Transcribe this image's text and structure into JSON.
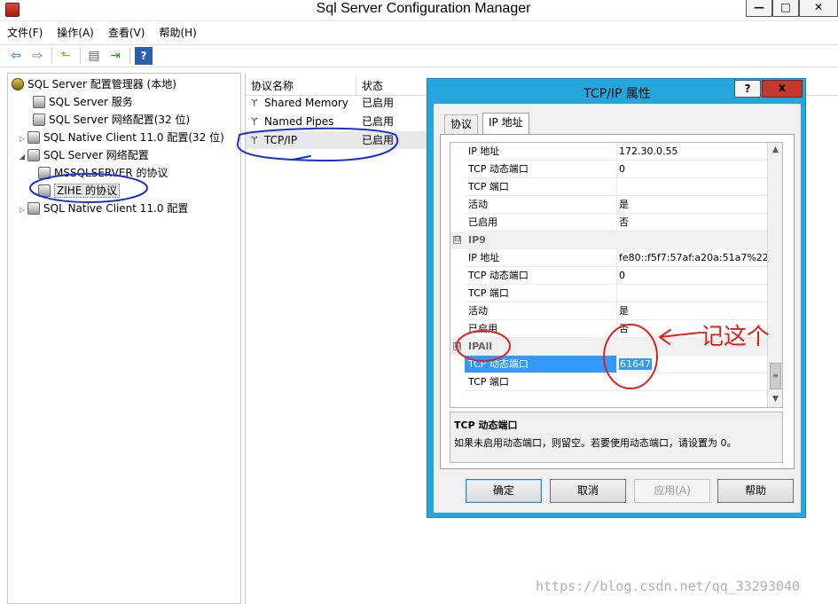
{
  "app": {
    "title": "Sql Server Configuration Manager",
    "window_controls": {
      "minimize": "—",
      "maximize": "□",
      "close": "✕"
    }
  },
  "menubar": [
    "文件(F)",
    "操作(A)",
    "查看(V)",
    "帮助(H)"
  ],
  "toolbar": {
    "icons": [
      "back-arrow-icon",
      "forward-arrow-icon",
      "up-folder-icon",
      "properties-icon",
      "export-icon",
      "help-icon"
    ],
    "glyphs": {
      "back": "⇦",
      "forward": "⇨",
      "up": "⬑",
      "properties": "▤",
      "export": "⇥",
      "help": "?"
    }
  },
  "tree": {
    "root": "SQL Server 配置管理器 (本地)",
    "items": [
      {
        "label": "SQL Server 服务",
        "level": 1
      },
      {
        "label": "SQL Server 网络配置(32 位)",
        "level": 1
      },
      {
        "label": "SQL Native Client 11.0 配置(32 位)",
        "level": 1,
        "toggle": "▷"
      },
      {
        "label": "SQL Server 网络配置",
        "level": 1,
        "toggle": "◢"
      },
      {
        "label": "MSSQLSERVER 的协议",
        "level": 2
      },
      {
        "label": "ZIHE 的协议",
        "level": 2,
        "selected": true
      },
      {
        "label": "SQL Native Client 11.0 配置",
        "level": 1,
        "toggle": "▷"
      }
    ]
  },
  "list": {
    "columns": [
      "协议名称",
      "状态"
    ],
    "rows": [
      {
        "name": "Shared Memory",
        "status": "已启用"
      },
      {
        "name": "Named Pipes",
        "status": "已启用"
      },
      {
        "name": "TCP/IP",
        "status": "已启用"
      }
    ]
  },
  "dialog": {
    "title": "TCP/IP 属性",
    "help": "?",
    "close": "x",
    "tabs": [
      "协议",
      "IP 地址"
    ],
    "active_tab": "IP 地址",
    "grid_rows": [
      {
        "type": "prop",
        "key": "IP 地址",
        "value": "172.30.0.55"
      },
      {
        "type": "prop",
        "key": "TCP 动态端口",
        "value": "0"
      },
      {
        "type": "prop",
        "key": "TCP 端口",
        "value": ""
      },
      {
        "type": "prop",
        "key": "活动",
        "value": "是"
      },
      {
        "type": "prop",
        "key": "已启用",
        "value": "否"
      },
      {
        "type": "cat",
        "key": "IP9",
        "toggle": "⊟"
      },
      {
        "type": "prop",
        "key": "IP 地址",
        "value": "fe80::f5f7:57af:a20a:51a7%22"
      },
      {
        "type": "prop",
        "key": "TCP 动态端口",
        "value": "0"
      },
      {
        "type": "prop",
        "key": "TCP 端口",
        "value": ""
      },
      {
        "type": "prop",
        "key": "活动",
        "value": "是"
      },
      {
        "type": "prop",
        "key": "已启用",
        "value": "否"
      },
      {
        "type": "cat",
        "key": "IPAll",
        "toggle": "⊟"
      },
      {
        "type": "prop",
        "key": "TCP 动态端口",
        "value": "61647",
        "selected": true
      },
      {
        "type": "prop",
        "key": "TCP 端口",
        "value": ""
      }
    ],
    "scroll": {
      "up": "▲",
      "down": "▼",
      "thumb": "≡"
    },
    "description": {
      "title": "TCP 动态端口",
      "text": "如果未启用动态端口，则留空。若要使用动态端口，请设置为 0。"
    },
    "buttons": {
      "ok": "确定",
      "cancel": "取消",
      "apply": "应用(A)",
      "help": "帮助"
    }
  },
  "annotation": {
    "handwritten_note": "记这个",
    "color": "#e0201d"
  },
  "watermark": "https://blog.csdn.net/qq_33293040",
  "colors": {
    "dialog_frame": "#27a5dd",
    "selection": "#3399ff",
    "annotation_blue": "#1a2fd6",
    "annotation_red": "#e0201d"
  }
}
